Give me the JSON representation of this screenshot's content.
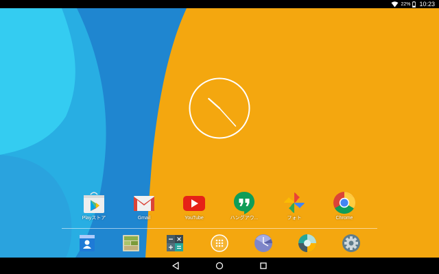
{
  "status_bar": {
    "battery_text": "22%",
    "time": "10:23",
    "icons": [
      "wifi-icon",
      "battery-icon"
    ]
  },
  "wallpaper": {
    "colors": {
      "orange": "#F4A70F",
      "blue": "#1F86D0",
      "light_blue": "#32C8EF",
      "sky": "#28AEE3"
    }
  },
  "clock_widget": {
    "hour": 10,
    "minute": 23
  },
  "apps": [
    {
      "label": "Playストア",
      "icon": "play-store-icon"
    },
    {
      "label": "Gmail",
      "icon": "gmail-icon"
    },
    {
      "label": "YouTube",
      "icon": "youtube-icon"
    },
    {
      "label": "ハングアウ...",
      "icon": "hangouts-icon"
    },
    {
      "label": "フォト",
      "icon": "photos-icon"
    },
    {
      "label": "Chrome",
      "icon": "chrome-icon"
    }
  ],
  "dock": [
    {
      "icon": "contacts-icon"
    },
    {
      "icon": "gallery-icon"
    },
    {
      "icon": "calculator-icon"
    },
    {
      "icon": "app-drawer-icon"
    },
    {
      "icon": "clock-app-icon"
    },
    {
      "icon": "camera-icon"
    },
    {
      "icon": "settings-icon"
    }
  ],
  "nav_bar": {
    "buttons": [
      "back-icon",
      "home-icon",
      "recents-icon"
    ]
  }
}
